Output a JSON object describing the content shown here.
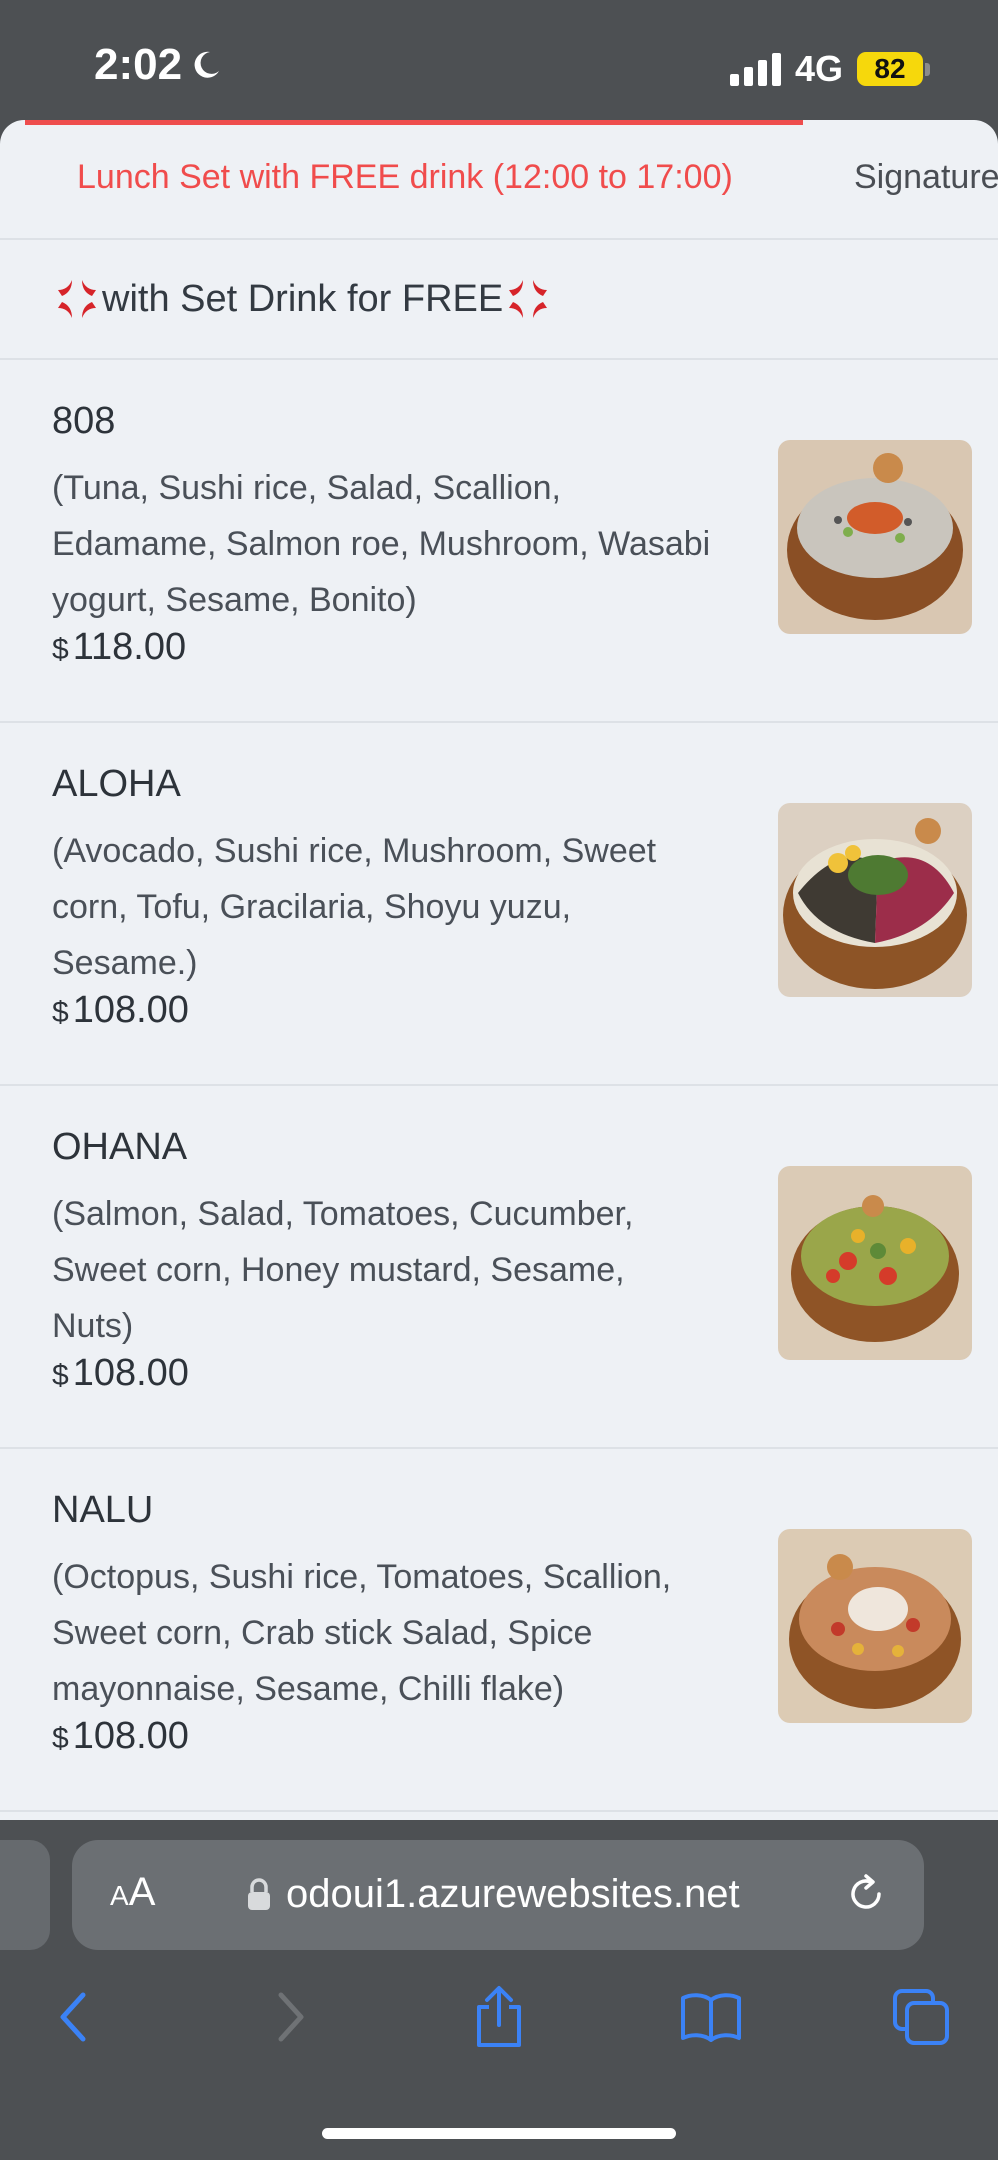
{
  "status": {
    "time": "2:02",
    "network": "4G",
    "battery": "82"
  },
  "tabs": {
    "active": "Lunch Set with FREE drink (12:00 to 17:00)",
    "next": "Signature"
  },
  "section": {
    "title": "with Set Drink for FREE"
  },
  "items": [
    {
      "name": "808",
      "description": "(Tuna, Sushi rice, Salad, Scallion, Edamame, Salmon roe, Mushroom, Wasabi yogurt, Sesame, Bonito)",
      "currency": "$",
      "price": "118.00"
    },
    {
      "name": "ALOHA",
      "description": "(Avocado, Sushi rice, Mushroom, Sweet corn, Tofu, Gracilaria, Shoyu yuzu, Sesame.)",
      "currency": "$",
      "price": "108.00"
    },
    {
      "name": "OHANA",
      "description": "(Salmon, Salad, Tomatoes, Cucumber, Sweet corn, Honey mustard, Sesame, Nuts)",
      "currency": "$",
      "price": "108.00"
    },
    {
      "name": "NALU",
      "description": "(Octopus, Sushi rice, Tomatoes, Scallion, Sweet corn, Crab stick Salad, Spice mayonnaise, Sesame, Chilli flake)",
      "currency": "$",
      "price": "108.00"
    }
  ],
  "browser": {
    "text_size_label": "AA",
    "url": "odoui1.azurewebsites.net"
  },
  "icons": {
    "status": [
      "moon-icon",
      "cellular-signal-icon",
      "battery-icon"
    ],
    "toolbar": [
      "back-icon",
      "forward-icon",
      "share-icon",
      "bookmarks-icon",
      "tabs-icon",
      "lock-icon",
      "reload-icon"
    ]
  },
  "colors": {
    "accent": "#f04c4c",
    "toolbar_blue": "#3b82f6",
    "battery": "#f6d80c"
  }
}
